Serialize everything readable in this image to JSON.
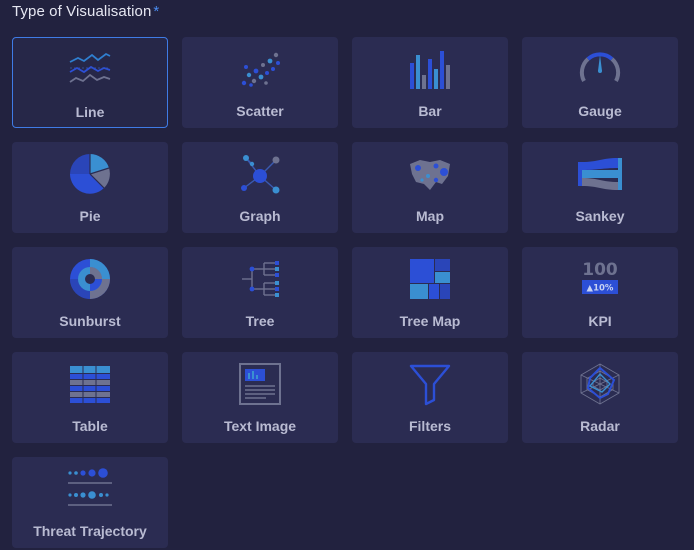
{
  "form": {
    "label": "Type of Visualisation",
    "required_marker": "*"
  },
  "visualisation_types": [
    {
      "label": "Line",
      "icon": "line-chart-icon",
      "selected": true
    },
    {
      "label": "Scatter",
      "icon": "scatter-chart-icon",
      "selected": false
    },
    {
      "label": "Bar",
      "icon": "bar-chart-icon",
      "selected": false
    },
    {
      "label": "Gauge",
      "icon": "gauge-icon",
      "selected": false
    },
    {
      "label": "Pie",
      "icon": "pie-chart-icon",
      "selected": false
    },
    {
      "label": "Graph",
      "icon": "graph-network-icon",
      "selected": false
    },
    {
      "label": "Map",
      "icon": "map-icon",
      "selected": false
    },
    {
      "label": "Sankey",
      "icon": "sankey-icon",
      "selected": false
    },
    {
      "label": "Sunburst",
      "icon": "sunburst-icon",
      "selected": false
    },
    {
      "label": "Tree",
      "icon": "tree-icon",
      "selected": false
    },
    {
      "label": "Tree Map",
      "icon": "treemap-icon",
      "selected": false
    },
    {
      "label": "KPI",
      "icon": "kpi-icon",
      "selected": false,
      "icon_value": "100",
      "icon_delta": "▲10%"
    },
    {
      "label": "Table",
      "icon": "table-icon",
      "selected": false
    },
    {
      "label": "Text Image",
      "icon": "text-image-icon",
      "selected": false
    },
    {
      "label": "Filters",
      "icon": "filter-funnel-icon",
      "selected": false
    },
    {
      "label": "Radar",
      "icon": "radar-chart-icon",
      "selected": false
    },
    {
      "label": "Threat Trajectory",
      "icon": "threat-trajectory-icon",
      "selected": false
    }
  ],
  "colors": {
    "background": "#22223f",
    "card": "#2b2c52",
    "selected_border": "#3f7be5",
    "accent_blue": "#2c4fd6",
    "accent_light": "#3a8fd1",
    "accent_grey": "#6e7290"
  }
}
